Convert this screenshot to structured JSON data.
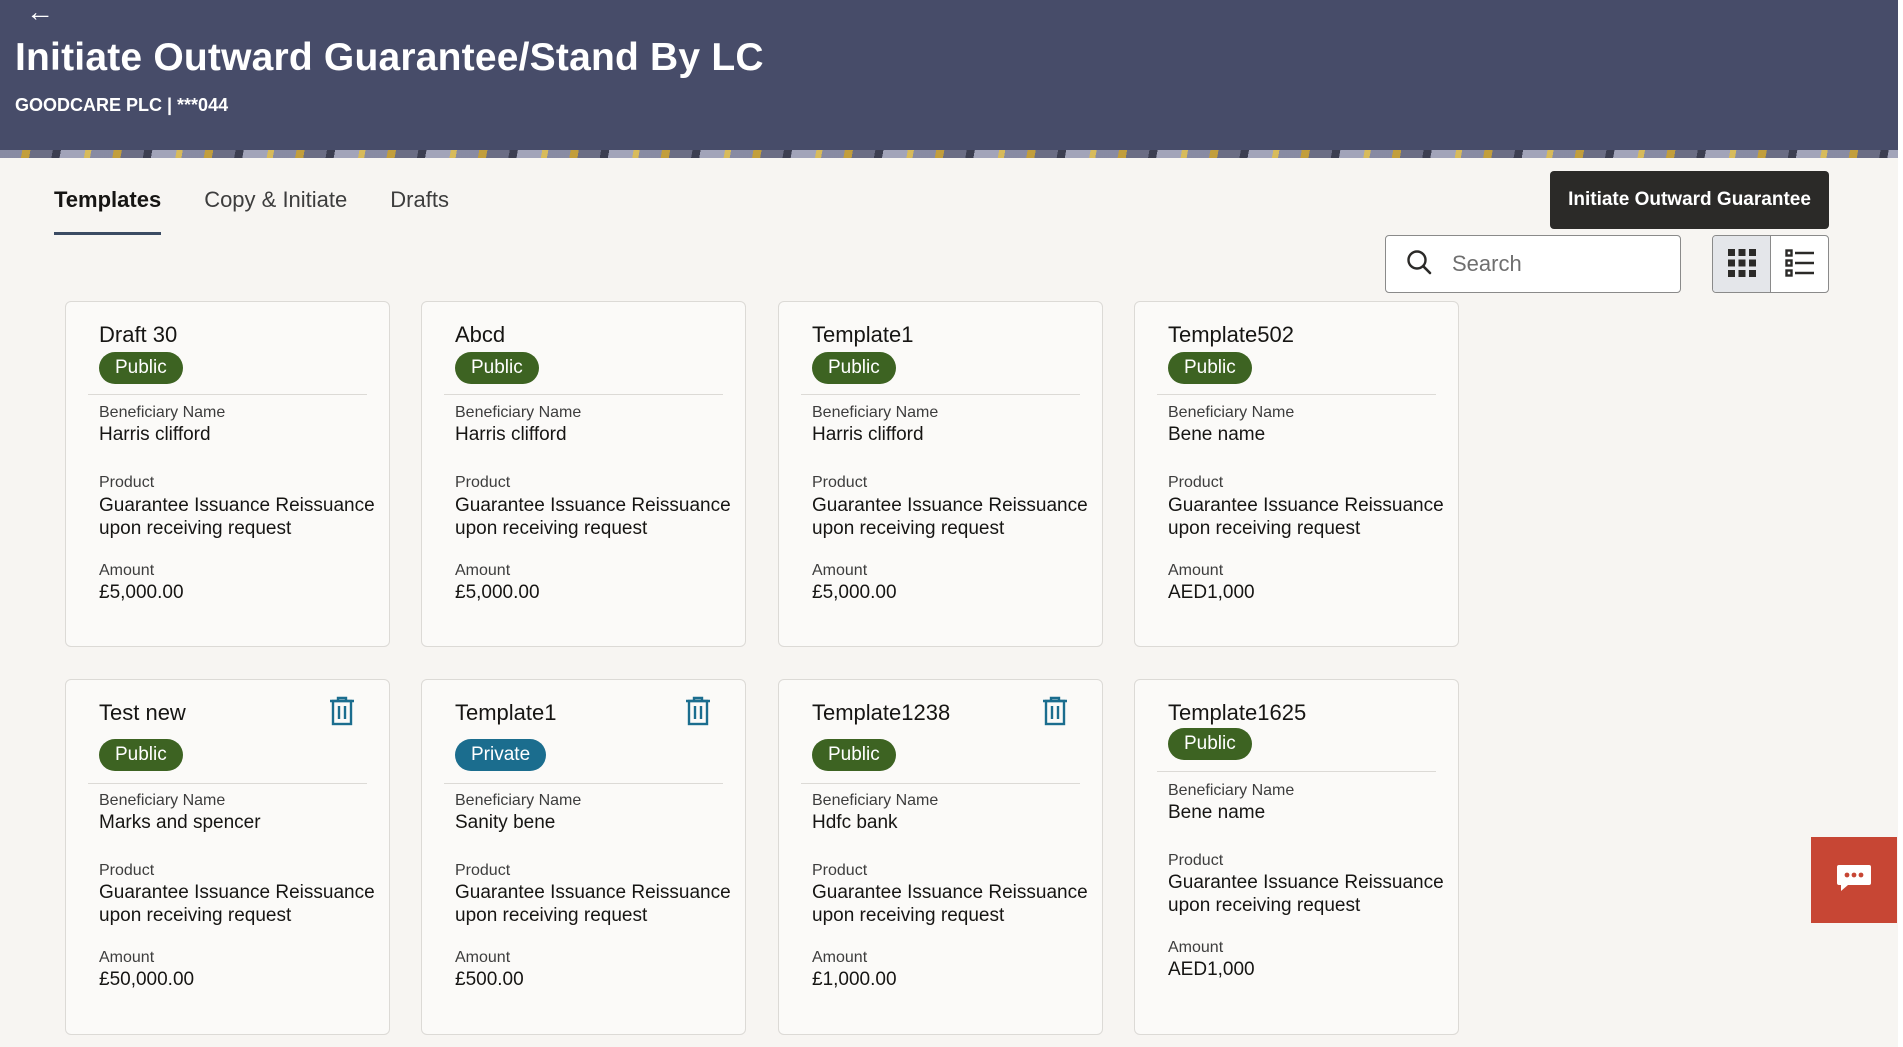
{
  "header": {
    "back_label": "←",
    "title": "Initiate Outward Guarantee/Stand By LC",
    "subtitle": "GOODCARE PLC | ***044"
  },
  "tabs": [
    {
      "label": "Templates",
      "active": true
    },
    {
      "label": "Copy & Initiate",
      "active": false
    },
    {
      "label": "Drafts",
      "active": false
    }
  ],
  "actions": {
    "initiate_label": "Initiate Outward Guarantee"
  },
  "search": {
    "placeholder": "Search",
    "value": ""
  },
  "field_labels": {
    "beneficiary": "Beneficiary Name",
    "product": "Product",
    "amount": "Amount"
  },
  "cards": [
    {
      "name": "Draft 30",
      "visibility": "Public",
      "beneficiary": "Harris clifford",
      "product": "Guarantee Issuance  Reissuance upon receiving request",
      "amount": "£5,000.00",
      "deletable": false
    },
    {
      "name": "Abcd",
      "visibility": "Public",
      "beneficiary": "Harris clifford",
      "product": "Guarantee Issuance  Reissuance upon receiving request",
      "amount": "£5,000.00",
      "deletable": false
    },
    {
      "name": "Template1",
      "visibility": "Public",
      "beneficiary": "Harris clifford",
      "product": "Guarantee Issuance  Reissuance upon receiving request",
      "amount": "£5,000.00",
      "deletable": false
    },
    {
      "name": "Template502",
      "visibility": "Public",
      "beneficiary": "Bene name",
      "product": "Guarantee Issuance Reissuance upon receiving request",
      "amount": "AED1,000",
      "deletable": false
    },
    {
      "name": "Test new",
      "visibility": "Public",
      "beneficiary": "Marks and spencer",
      "product": "Guarantee Issuance  Reissuance upon receiving request",
      "amount": "£50,000.00",
      "deletable": true
    },
    {
      "name": "Template1",
      "visibility": "Private",
      "beneficiary": "Sanity bene",
      "product": "Guarantee Issuance  Reissuance upon receiving request",
      "amount": "£500.00",
      "deletable": true
    },
    {
      "name": "Template1238",
      "visibility": "Public",
      "beneficiary": "Hdfc bank",
      "product": "Guarantee Issuance  Reissuance upon receiving request",
      "amount": "£1,000.00",
      "deletable": true
    },
    {
      "name": "Template1625",
      "visibility": "Public",
      "beneficiary": "Bene name",
      "product": "Guarantee Issuance Reissuance upon receiving request",
      "amount": "AED1,000",
      "deletable": false
    }
  ],
  "colors": {
    "header": "#474c69",
    "public": "#3d6322",
    "private": "#1b6d8e",
    "chat": "#c74634"
  },
  "icons": {
    "back": "arrow-left-icon",
    "search": "search-icon",
    "grid": "grid-view-icon",
    "list": "list-view-icon",
    "delete": "trash-icon",
    "chat": "chat-icon"
  }
}
